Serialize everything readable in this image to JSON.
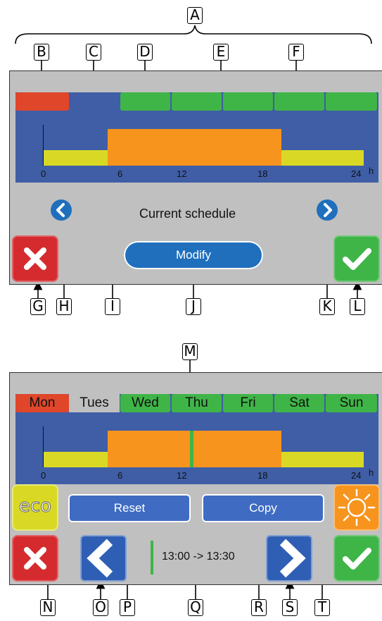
{
  "callouts": {
    "A": "A",
    "B": "B",
    "C": "C",
    "D": "D",
    "E": "E",
    "F": "F",
    "G": "G",
    "H": "H",
    "I": "I",
    "J": "J",
    "K": "K",
    "L": "L",
    "M": "M",
    "N": "N",
    "O": "O",
    "P": "P",
    "Q": "Q",
    "R": "R",
    "S": "S",
    "T": "T"
  },
  "top_panel": {
    "ticks": [
      "0",
      "6",
      "12",
      "18",
      "24"
    ],
    "hour_unit": "h",
    "status_text": "Current schedule",
    "modify_label": "Modify"
  },
  "bottom_panel": {
    "days": [
      "Mon",
      "Tues",
      "Wed",
      "Thu",
      "Fri",
      "Sat",
      "Sun"
    ],
    "ticks": [
      "0",
      "6",
      "12",
      "18",
      "24"
    ],
    "hour_unit": "h",
    "eco_label": "eco",
    "reset_label": "Reset",
    "copy_label": "Copy",
    "time_range": "13:00 -> 13:30"
  },
  "colors": {
    "panel_bg": "#c0c0c0",
    "screen_bg": "#3f5ea6",
    "current_day": "#e0462a",
    "active_day": "#3fb548",
    "comfort": "#f7941d",
    "eco": "#d9d925",
    "confirm": "#3fb548",
    "cancel": "#d52b2f",
    "action_blue": "#1f6fbd"
  },
  "icons": {
    "cancel": "x-icon",
    "confirm": "checkmark-icon",
    "prev": "chevron-left-icon",
    "next": "chevron-right-icon",
    "comfort": "sun-icon"
  }
}
